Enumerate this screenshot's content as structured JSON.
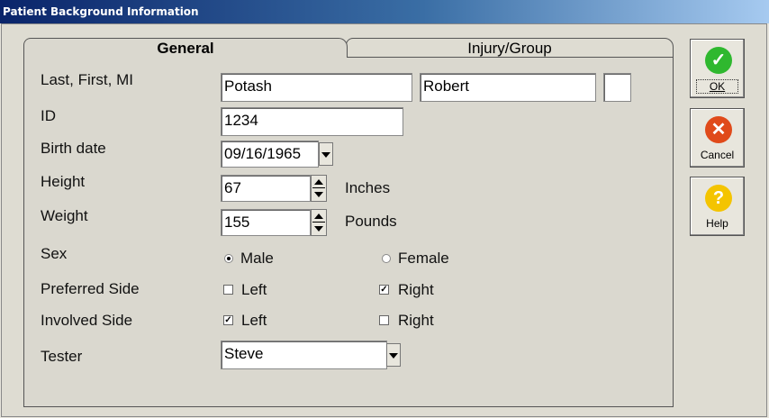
{
  "window": {
    "title": "Patient Background Information"
  },
  "tabs": [
    {
      "label": "General"
    },
    {
      "label": "Injury/Group"
    }
  ],
  "labels": {
    "name": "Last, First, MI",
    "id": "ID",
    "birth": "Birth date",
    "height": "Height",
    "weight": "Weight",
    "sex": "Sex",
    "preferred": "Preferred Side",
    "involved": "Involved Side",
    "tester": "Tester"
  },
  "fields": {
    "last": "Potash",
    "first": "Robert",
    "mi": "",
    "id": "1234",
    "birth": "09/16/1965",
    "height": "67",
    "height_unit": "Inches",
    "weight": "155",
    "weight_unit": "Pounds",
    "tester": "Steve"
  },
  "sex": {
    "male": "Male",
    "female": "Female",
    "selected": "Male"
  },
  "preferred": {
    "left": "Left",
    "right": "Right",
    "left_checked": false,
    "right_checked": true
  },
  "involved": {
    "left": "Left",
    "right": "Right",
    "left_checked": true,
    "right_checked": false
  },
  "buttons": {
    "ok": "OK",
    "cancel": "Cancel",
    "help": "Help"
  },
  "icons": {
    "ok": "check-circle-icon",
    "cancel": "x-circle-icon",
    "help": "question-circle-icon"
  },
  "colors": {
    "ok": "#2fb82f",
    "cancel": "#e04a1a",
    "help": "#f4c400",
    "title_start": "#0a246a"
  }
}
